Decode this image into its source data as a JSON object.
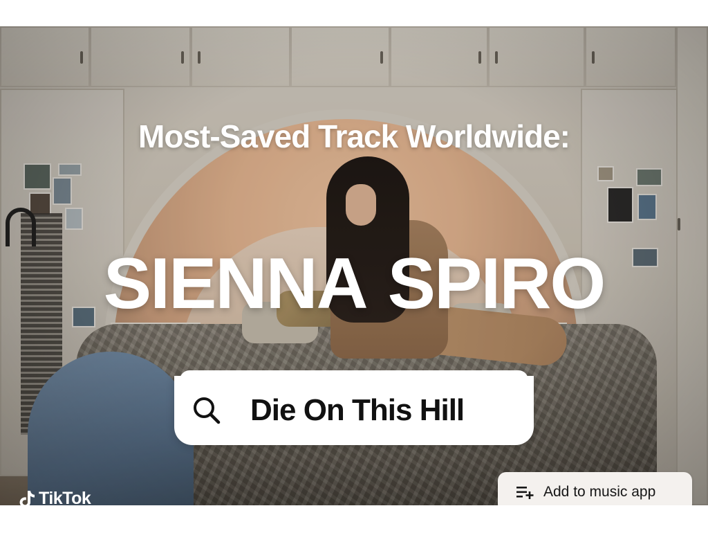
{
  "promo": {
    "headline": "Most-Saved Track Worldwide:",
    "artist_first": "SIENNA",
    "artist_last": "SPIRO",
    "song_title": "Die On This Hill"
  },
  "brand": {
    "name": "TikTok",
    "icon": "tiktok-note-icon"
  },
  "actions": {
    "add_to_music_app": "Add to music app",
    "add_icon": "playlist-add-icon",
    "search_icon": "search-icon"
  },
  "colors": {
    "text_primary": "#ffffff",
    "pill_background": "#ffffff",
    "button_background": "#f4f1ee",
    "song_text": "#111111"
  }
}
